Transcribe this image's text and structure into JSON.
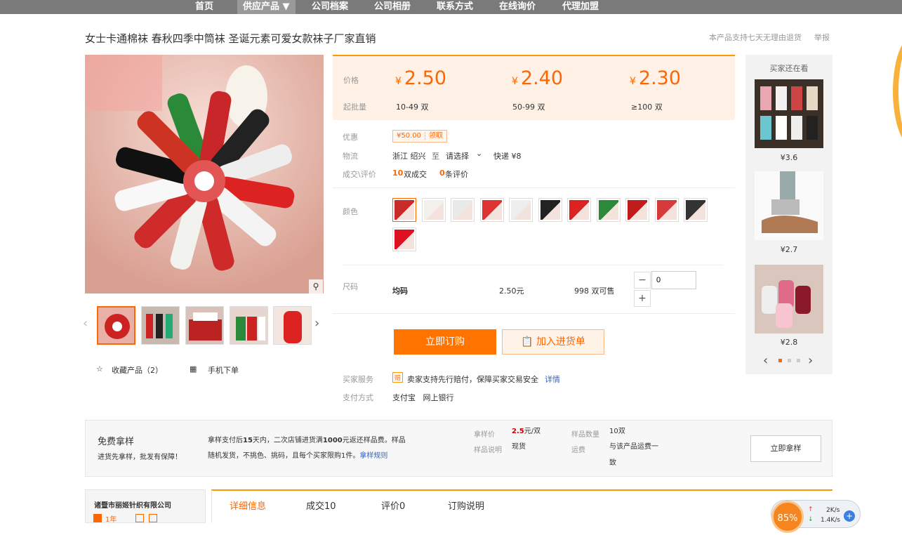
{
  "nav": [
    "首页",
    "供应产品 ▼",
    "公司档案",
    "公司相册",
    "联系方式",
    "在线询价",
    "代理加盟"
  ],
  "product": {
    "title": "女士卡通棉袜 春秋四季中筒袜 圣诞元素可爱女款袜子厂家直销",
    "return_note": "本产品支持七天无理由退货",
    "report": "举报"
  },
  "prices": {
    "label_price": "价格",
    "label_moq": "起批量",
    "currency": "¥",
    "tiers": [
      {
        "price": "2.50",
        "qty": "10-49 双"
      },
      {
        "price": "2.40",
        "qty": "50-99 双"
      },
      {
        "price": "2.30",
        "qty": "≥100 双"
      }
    ]
  },
  "promo": {
    "label": "优惠",
    "amount": "¥50.00",
    "claim": "领取"
  },
  "logistics": {
    "label": "物流",
    "from": "浙江 绍兴",
    "to_word": "至",
    "select": "请选择",
    "express": "快递 ¥8"
  },
  "deals": {
    "label": "成交\\评价",
    "count": "10",
    "count_unit": "双成交",
    "reviews": "0",
    "reviews_unit": "条评价"
  },
  "color": {
    "label": "颜色",
    "swatch_colors": [
      "#c92a2a",
      "#f4f0ee",
      "#e9e9e9",
      "#d33",
      "#eee",
      "#222",
      "#d22",
      "#2a8a3a",
      "#c01c1c",
      "#d63b3b",
      "#333",
      "#d12"
    ]
  },
  "size": {
    "label": "尺码",
    "name": "均码",
    "price": "2.50元",
    "stock": "998 双可售",
    "qty": "0",
    "minus": "−",
    "plus": "+"
  },
  "actions": {
    "order": "立即订购",
    "cart": "加入进货单"
  },
  "service": {
    "label": "买家服务",
    "text": "卖家支持先行赔付，保障买家交易安全",
    "link": "详情"
  },
  "payment": {
    "label": "支付方式",
    "methods": "支付宝   网上银行"
  },
  "thumbs_gallery": {
    "favorite": "收藏产品（2）",
    "mobile": "手机下单"
  },
  "recommend": {
    "title": "买家还在看",
    "items": [
      {
        "price": "¥3.6"
      },
      {
        "price": "¥2.7"
      },
      {
        "price": "¥2.8"
      }
    ]
  },
  "sample": {
    "title": "免费拿样",
    "subtitle": "进货先拿样，批发有保障！",
    "desc1_a": "拿样支付后",
    "desc1_b": "15",
    "desc1_c": "天内，二次店铺进货满",
    "desc1_d": "1000",
    "desc1_e": "元返还样品费。样品",
    "desc2": "随机发货，不挑色、挑码，且每个买家限购1件。",
    "rules": "拿样规则",
    "price_label": "拿样价",
    "price_val": "2.5",
    "price_unit": "元/双",
    "qty_label": "样品数量",
    "qty_val": "10双",
    "note_label": "样品说明",
    "note_val": "现货",
    "ship_label": "运费",
    "ship_val1": "与该产品运费一",
    "ship_val2": "致",
    "button": "立即拿样"
  },
  "company": {
    "name": "诸暨市丽姬针织有限公司",
    "years": "1年"
  },
  "tabs": [
    "详细信息",
    "成交10",
    "评价0",
    "订购说明"
  ],
  "widget": {
    "percent": "85%",
    "up": "2K/s",
    "down": "1.4K/s"
  }
}
